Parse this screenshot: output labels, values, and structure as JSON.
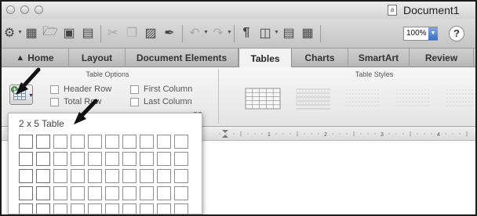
{
  "window": {
    "title": "Document1"
  },
  "toolbar": {
    "zoom_value": "100%",
    "icons": [
      "gallery-icon",
      "templates-icon",
      "open-icon",
      "save-icon",
      "print-icon",
      "cut-icon",
      "copy-icon",
      "paste-icon",
      "format-painter-icon",
      "undo-icon",
      "redo-icon",
      "pilcrow-icon",
      "sidebar-icon",
      "media-icon",
      "table-icon",
      "help-icon"
    ],
    "help_label": "?"
  },
  "ribbon_tabs": [
    {
      "label": "Home",
      "icon": "home-icon"
    },
    {
      "label": "Layout"
    },
    {
      "label": "Document Elements"
    },
    {
      "label": "Tables",
      "active": true
    },
    {
      "label": "Charts"
    },
    {
      "label": "SmartArt"
    },
    {
      "label": "Review"
    }
  ],
  "ribbon": {
    "table_options": {
      "title": "Table Options",
      "header_row": "Header Row",
      "total_row": "Total Row",
      "first_column": "First Column",
      "last_column": "Last Column",
      "third_col_partial": "ns"
    },
    "table_styles": {
      "title": "Table Styles"
    }
  },
  "ruler": {
    "numbers": [
      "1",
      "2",
      "3",
      "4"
    ]
  },
  "table_dropdown": {
    "label": "2 x 5 Table",
    "highlight_cols": 2,
    "highlight_rows": 5
  }
}
